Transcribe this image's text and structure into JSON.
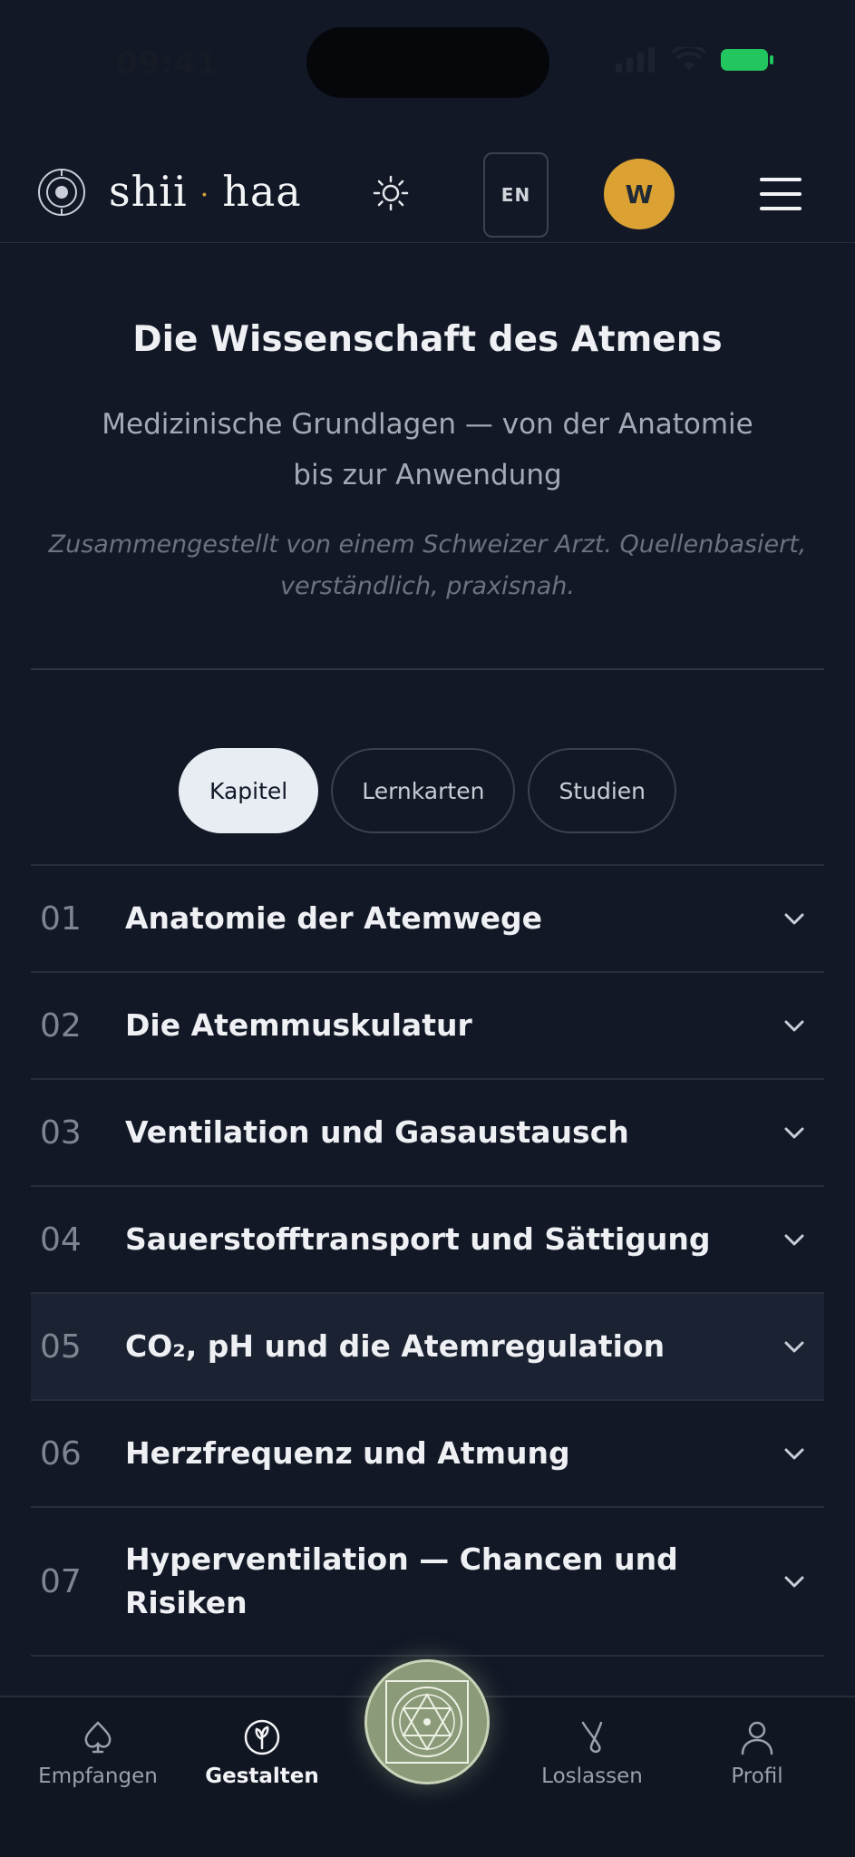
{
  "status_bar": {
    "time": "09:41"
  },
  "header": {
    "logo_part1": "shii",
    "logo_separator": "·",
    "logo_part2": "haa",
    "lang_label": "EN",
    "avatar_initial": "W"
  },
  "hero": {
    "title": "Die Wissenschaft des Atmens",
    "subtitle": "Medizinische Grundlagen — von der Anatomie bis zur Anwendung",
    "note": "Zusammengestellt von einem Schweizer Arzt. Quellenbasiert, verständlich, praxisnah."
  },
  "tabs": [
    {
      "label": "Kapitel",
      "active": true
    },
    {
      "label": "Lernkarten",
      "active": false
    },
    {
      "label": "Studien",
      "active": false
    }
  ],
  "chapters": [
    {
      "num": "01",
      "title": "Anatomie der Atemwege"
    },
    {
      "num": "02",
      "title": "Die Atemmuskulatur"
    },
    {
      "num": "03",
      "title": "Ventilation und Gasaustausch"
    },
    {
      "num": "04",
      "title": "Sauerstofftransport und Sättigung"
    },
    {
      "num": "05",
      "title": "CO₂, pH und die Atemregulation"
    },
    {
      "num": "06",
      "title": "Herzfrequenz und Atmung"
    },
    {
      "num": "07",
      "title": "Hyperventilation — Chancen und Risiken"
    }
  ],
  "bottom_nav": {
    "items": [
      {
        "label": "Empfangen",
        "icon": "spade-leaf-icon"
      },
      {
        "label": "Gestalten",
        "icon": "sprout-icon"
      },
      {
        "label": "Loslassen",
        "icon": "release-icon"
      },
      {
        "label": "Profil",
        "icon": "user-icon"
      }
    ],
    "active_index": 1,
    "center_icon": "yantra-icon"
  },
  "colors": {
    "background": "#121826",
    "accent_gold": "#dba233",
    "battery_green": "#22c55e",
    "center_button": "#8b9a78"
  }
}
